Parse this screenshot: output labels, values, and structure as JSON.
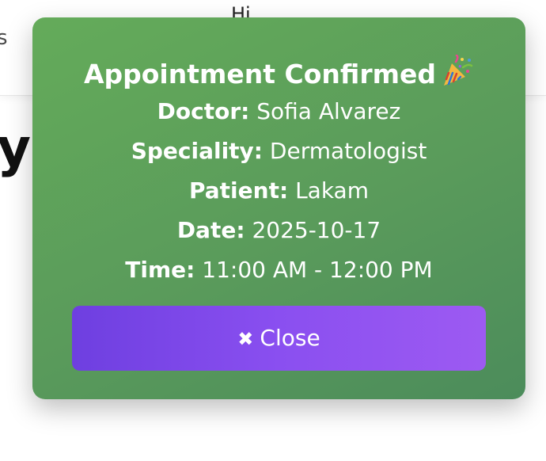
{
  "background": {
    "left_fragment": "s",
    "top_fragment": "Hi",
    "heading_fragment": "y"
  },
  "modal": {
    "title": "Appointment Confirmed",
    "title_icon": "party-popper-icon",
    "details": [
      {
        "label": "Doctor:",
        "value": "Sofia Alvarez"
      },
      {
        "label": "Speciality:",
        "value": "Dermatologist"
      },
      {
        "label": "Patient:",
        "value": "Lakam"
      },
      {
        "label": "Date:",
        "value": "2025-10-17"
      },
      {
        "label": "Time:",
        "value": "11:00 AM - 12:00 PM"
      }
    ],
    "close_icon": "✖",
    "close_label": "Close"
  },
  "colors": {
    "modal_green": "#5fa35a",
    "button_purple_start": "#6e3fe0",
    "button_purple_end": "#9d5af2",
    "text": "#ffffff"
  }
}
